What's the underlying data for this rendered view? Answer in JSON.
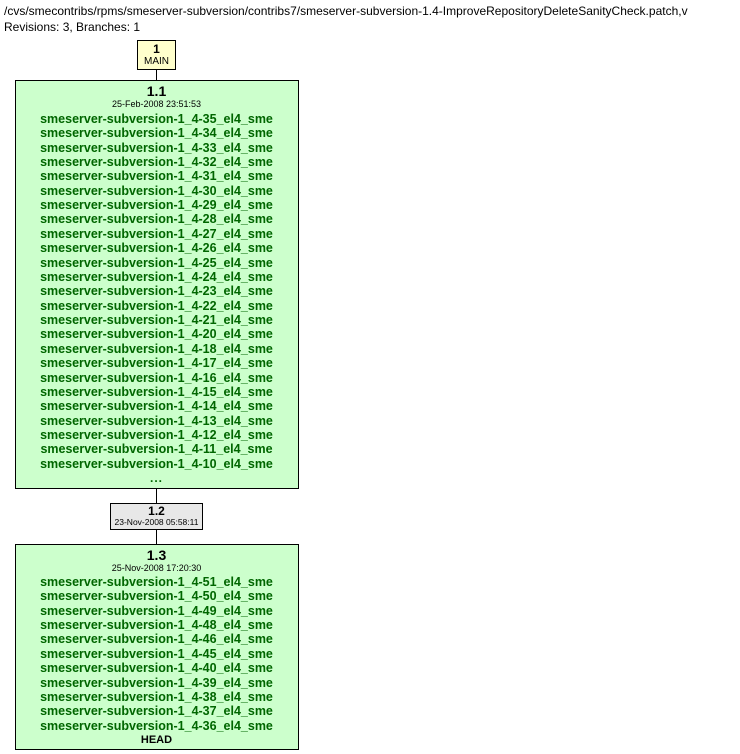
{
  "header": {
    "path": "/cvs/smecontribs/rpms/smeserver-subversion/contribs7/smeserver-subversion-1.4-ImproveRepositoryDeleteSanityCheck.patch,v",
    "meta": "Revisions: 3, Branches: 1"
  },
  "nodes": {
    "main": {
      "num": "1",
      "label": "MAIN"
    },
    "rev11": {
      "rev": "1.1",
      "date": "25-Feb-2008 23:51:53",
      "tags": [
        "smeserver-subversion-1_4-35_el4_sme",
        "smeserver-subversion-1_4-34_el4_sme",
        "smeserver-subversion-1_4-33_el4_sme",
        "smeserver-subversion-1_4-32_el4_sme",
        "smeserver-subversion-1_4-31_el4_sme",
        "smeserver-subversion-1_4-30_el4_sme",
        "smeserver-subversion-1_4-29_el4_sme",
        "smeserver-subversion-1_4-28_el4_sme",
        "smeserver-subversion-1_4-27_el4_sme",
        "smeserver-subversion-1_4-26_el4_sme",
        "smeserver-subversion-1_4-25_el4_sme",
        "smeserver-subversion-1_4-24_el4_sme",
        "smeserver-subversion-1_4-23_el4_sme",
        "smeserver-subversion-1_4-22_el4_sme",
        "smeserver-subversion-1_4-21_el4_sme",
        "smeserver-subversion-1_4-20_el4_sme",
        "smeserver-subversion-1_4-18_el4_sme",
        "smeserver-subversion-1_4-17_el4_sme",
        "smeserver-subversion-1_4-16_el4_sme",
        "smeserver-subversion-1_4-15_el4_sme",
        "smeserver-subversion-1_4-14_el4_sme",
        "smeserver-subversion-1_4-13_el4_sme",
        "smeserver-subversion-1_4-12_el4_sme",
        "smeserver-subversion-1_4-11_el4_sme",
        "smeserver-subversion-1_4-10_el4_sme"
      ],
      "ellipsis": "..."
    },
    "rev12": {
      "rev": "1.2",
      "date": "23-Nov-2008 05:58:11"
    },
    "rev13": {
      "rev": "1.3",
      "date": "25-Nov-2008 17:20:30",
      "tags": [
        "smeserver-subversion-1_4-51_el4_sme",
        "smeserver-subversion-1_4-50_el4_sme",
        "smeserver-subversion-1_4-49_el4_sme",
        "smeserver-subversion-1_4-48_el4_sme",
        "smeserver-subversion-1_4-46_el4_sme",
        "smeserver-subversion-1_4-45_el4_sme",
        "smeserver-subversion-1_4-40_el4_sme",
        "smeserver-subversion-1_4-39_el4_sme",
        "smeserver-subversion-1_4-38_el4_sme",
        "smeserver-subversion-1_4-37_el4_sme",
        "smeserver-subversion-1_4-36_el4_sme"
      ],
      "head": "HEAD"
    }
  }
}
